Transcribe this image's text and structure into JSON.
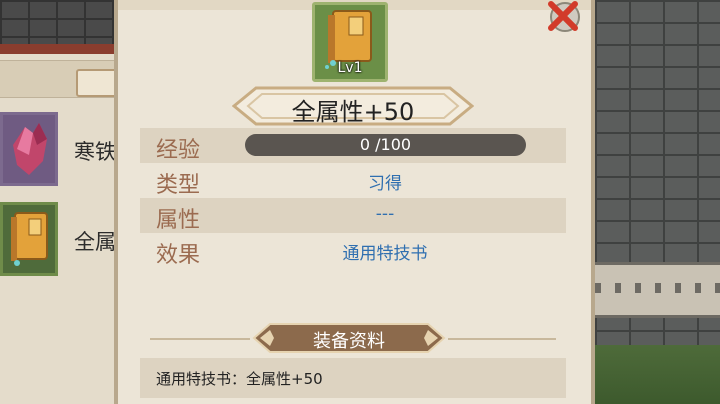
{
  "item": {
    "level": "Lv1",
    "title": "全属性+50"
  },
  "stats": {
    "exp": {
      "key": "经验",
      "current": 0,
      "max": 100,
      "text": "0 /100"
    },
    "type": {
      "key": "类型",
      "value": "习得"
    },
    "attribute": {
      "key": "属性",
      "value": "---"
    },
    "effect": {
      "key": "效果",
      "value": "通用特技书"
    }
  },
  "section": {
    "title": "装备资料"
  },
  "description": "通用特技书：全属性+50",
  "left_list": [
    {
      "label": "寒铁"
    },
    {
      "label": "全属"
    }
  ],
  "colors": {
    "stat_key": "#9b6b50",
    "stat_value": "#2f6fb0",
    "panel_bg": "#ece5d7",
    "banner_brown": "#8c6a4c",
    "close_red": "#d23b2a"
  },
  "icons": {
    "close": "close-x-icon",
    "item": "book-icon",
    "list_item_1": "crystal-icon",
    "list_item_2": "book-icon"
  }
}
